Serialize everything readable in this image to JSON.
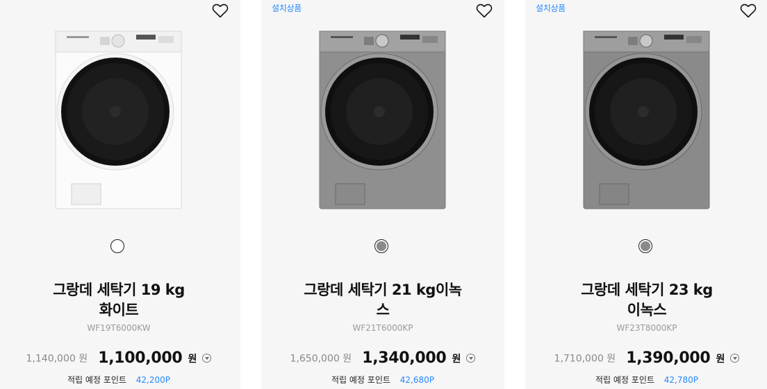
{
  "colors": {
    "accent": "#2189ff",
    "card_bg": "#f6f6f6"
  },
  "products": [
    {
      "badge": "",
      "wishlist_icon": "heart-outline-icon",
      "color_swatch": "#ffffff",
      "title_line1": "그랑데 세탁기 19 kg",
      "title_line2": "화이트",
      "model": "WF19T6000KW",
      "original_price": "1,140,000 원",
      "sale_price": "1,100,000",
      "currency": "원",
      "points_label": "적립 예정 포인트",
      "points_value": "42,200P"
    },
    {
      "badge": "설치상품",
      "wishlist_icon": "heart-outline-icon",
      "color_swatch": "#8a8a8a",
      "title_line1": "그랑데 세탁기 21 kg이녹스",
      "title_line2": "",
      "model": "WF21T6000KP",
      "original_price": "1,650,000 원",
      "sale_price": "1,340,000",
      "currency": "원",
      "points_label": "적립 예정 포인트",
      "points_value": "42,680P"
    },
    {
      "badge": "설치상품",
      "wishlist_icon": "heart-outline-icon",
      "color_swatch": "#8a8a8a",
      "title_line1": "그랑데 세탁기 23 kg",
      "title_line2": "이녹스",
      "model": "WF23T8000KP",
      "original_price": "1,710,000 원",
      "sale_price": "1,390,000",
      "currency": "원",
      "points_label": "적립 예정 포인트",
      "points_value": "42,780P"
    }
  ]
}
